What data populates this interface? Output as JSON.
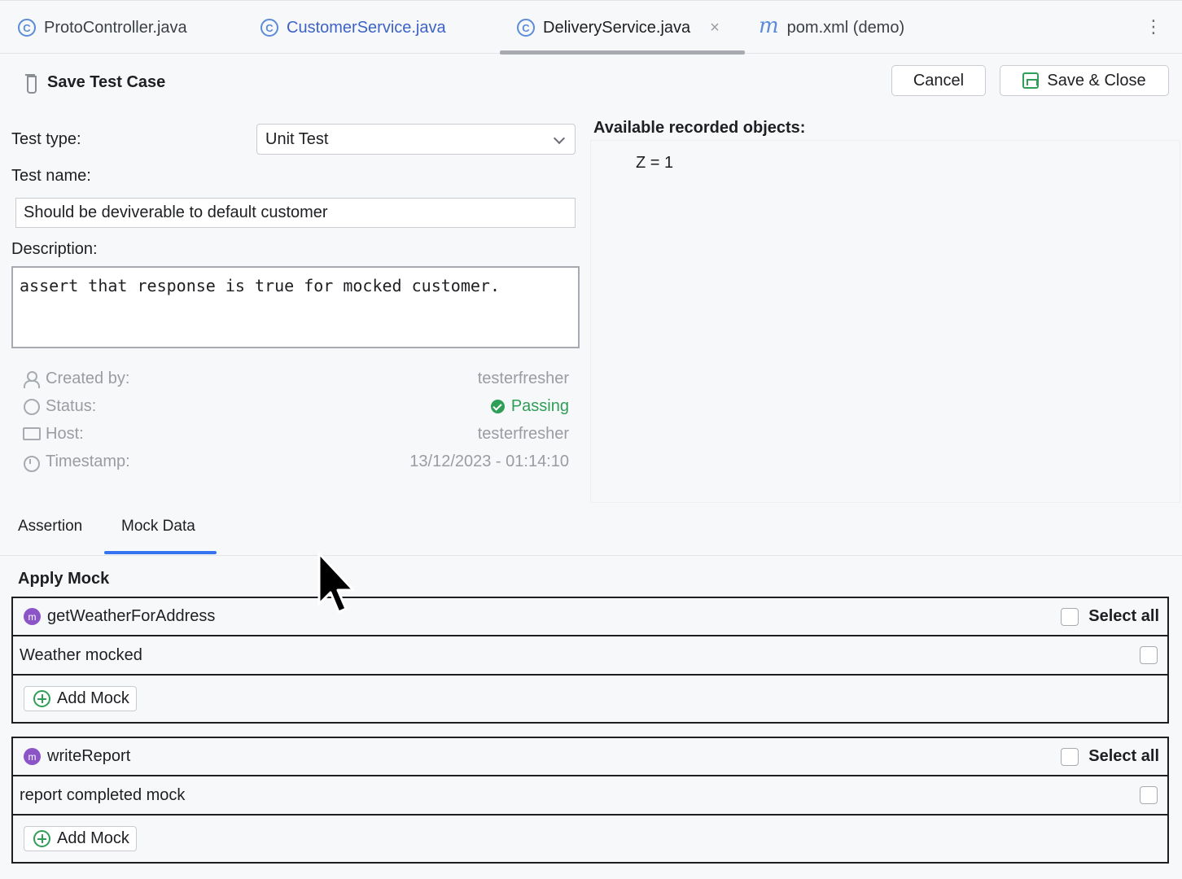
{
  "tabs": [
    {
      "label": "ProtoController.java",
      "icon": "class-icon"
    },
    {
      "label": "CustomerService.java",
      "icon": "class-icon"
    },
    {
      "label": "DeliveryService.java",
      "icon": "class-icon",
      "active": true
    },
    {
      "label": "pom.xml (demo)",
      "icon": "maven-icon"
    }
  ],
  "tab_close_glyph": "×",
  "header": {
    "title": "Save Test Case",
    "cancel_label": "Cancel",
    "save_close_label": "Save & Close"
  },
  "form": {
    "test_type_label": "Test type:",
    "test_type_value": "Unit Test",
    "test_name_label": "Test name:",
    "test_name_value": "Should be deviverable to default customer",
    "description_label": "Description:",
    "description_value": "assert that response is true for mocked customer."
  },
  "meta": {
    "created_by_label": "Created by:",
    "created_by_value": "testerfresher",
    "status_label": "Status:",
    "status_value": "Passing",
    "host_label": "Host:",
    "host_value": "testerfresher",
    "timestamp_label": "Timestamp:",
    "timestamp_value": "13/12/2023 - 01:14:10"
  },
  "recorded": {
    "title": "Available recorded objects:",
    "objects": [
      "Z = 1"
    ]
  },
  "subtabs": {
    "assertion": "Assertion",
    "mock_data": "Mock Data",
    "active": "Mock Data"
  },
  "apply_mock": {
    "title": "Apply Mock",
    "groups": [
      {
        "method": "getWeatherForAddress",
        "icon_letter": "m",
        "select_all": "Select all",
        "mocks": [
          "Weather mocked"
        ],
        "add_label": "Add Mock"
      },
      {
        "method": "writeReport",
        "icon_letter": "m",
        "select_all": "Select all",
        "mocks": [
          "report completed mock"
        ],
        "add_label": "Add Mock"
      }
    ]
  },
  "colors": {
    "accent": "#3574f0",
    "passing": "#2f9e57",
    "method_icon": "#8b55c8"
  }
}
